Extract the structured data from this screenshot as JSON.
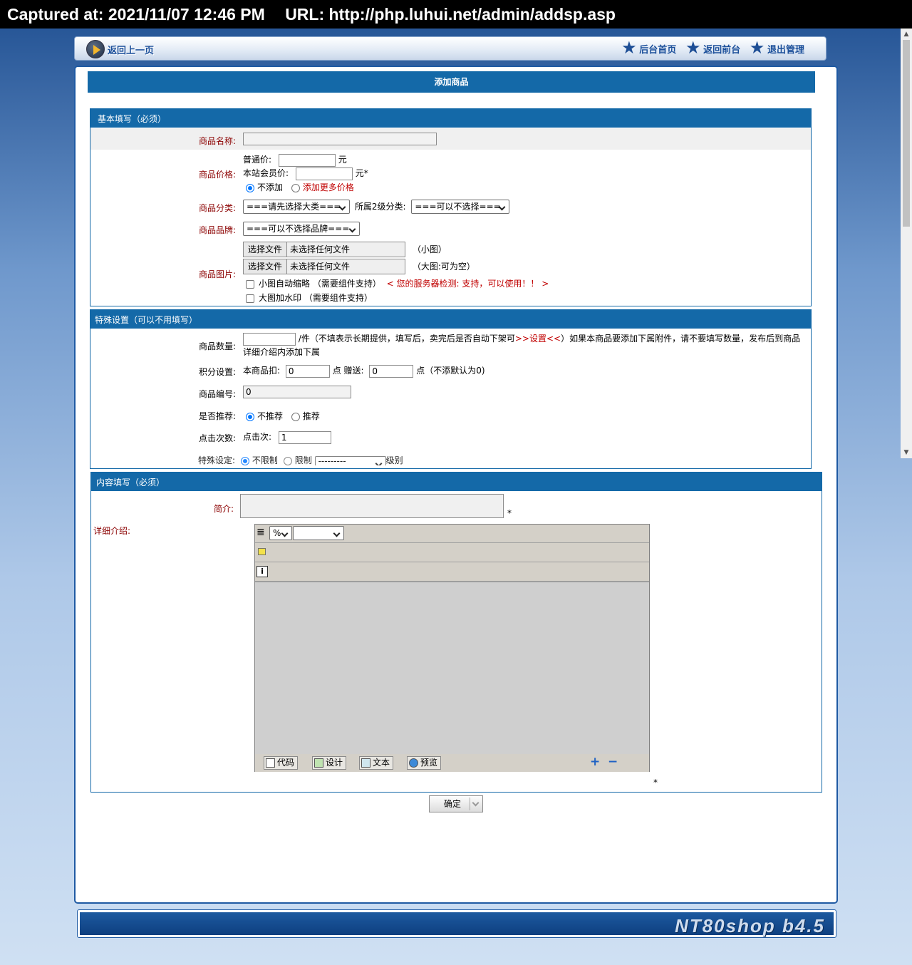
{
  "capture": {
    "captured_at": "Captured at: 2021/11/07 12:46 PM",
    "url": "URL: http://php.luhui.net/admin/addsp.asp"
  },
  "topbar": {
    "back_label": "返回上一页",
    "links": [
      "后台首页",
      "返回前台",
      "退出管理"
    ]
  },
  "page": {
    "title": "添加商品"
  },
  "basic": {
    "header": "基本填写（必须）",
    "name_label": "商品名称:",
    "price_label": "商品价格:",
    "normal_price": "普通价:",
    "member_price": "本站会员价:",
    "yuan": "元",
    "yuan_required": "元*",
    "no_add": "不添加",
    "add_more_price": "添加更多价格",
    "category_label": "商品分类:",
    "category_select": "===请先选择大类===",
    "subcategory_label": "所属2级分类:",
    "subcategory_select": "===可以不选择===",
    "brand_label": "商品品牌:",
    "brand_select": "===可以不选择品牌===",
    "image_label": "商品图片:",
    "file_button": "选择文件",
    "no_file": "未选择任何文件",
    "small_img": "（小图）",
    "large_img": "（大图:可为空）",
    "auto_thumb": "小图自动缩略 （需要组件支持）",
    "server_check": "< 您的服务器检测:  支持，可以使用！！ >",
    "watermark": "大图加水印 （需要组件支持）"
  },
  "special": {
    "header": "特殊设置（可以不用填写）",
    "qty_label": "商品数量:",
    "qty_text_a": "/件（不填表示长期提供，填写后，卖完后是否自动下架可",
    "qty_link": ">>设置<<",
    "qty_text_b": "）如果本商品要添加下属附件，请不要填写数量，发布后到商品",
    "qty_text_c": "详细介绍内添加下属",
    "points_label": "积分设置:",
    "points_deduct": "本商品扣:",
    "points_value": "0",
    "points_gift": "点 赠送:",
    "gift_value": "0",
    "points_note": "点（不添默认为0)",
    "code_label": "商品编号:",
    "code_value": "0",
    "recommend_label": "是否推荐:",
    "not_recommend": "不推荐",
    "recommend": "推荐",
    "clicks_label": "点击次数:",
    "clicks_sub": "点击次:",
    "clicks_value": "1",
    "special_label": "特殊设定:",
    "unlimited": "不限制",
    "limited": "限制",
    "level_select": "---------",
    "level_suffix": "级别"
  },
  "content": {
    "header": "内容填写（必须）",
    "intro_label": "简介:",
    "required_mark": "*",
    "detail_label": "详细介绍:",
    "zoom_select": "%",
    "modes": [
      "代码",
      "设计",
      "文本",
      "预览"
    ],
    "plus": "+",
    "minus": "−"
  },
  "submit_label": "确定",
  "footer": {
    "brand": "NT80shop b4.5"
  },
  "colors": {
    "header_blue": "#1469a8",
    "label_red": "#8b0000",
    "link_red": "#c00000"
  }
}
